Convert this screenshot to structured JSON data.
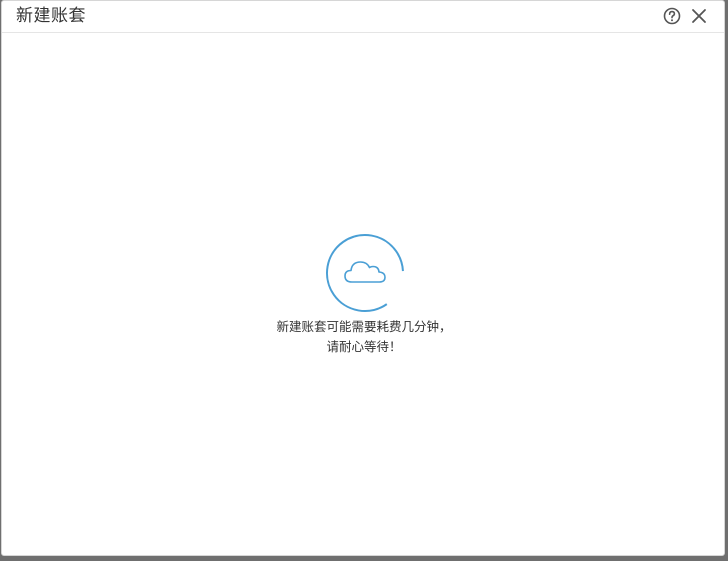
{
  "dialog": {
    "title": "新建账套",
    "help_icon": "help-circle-icon",
    "close_icon": "close-icon"
  },
  "loading": {
    "icon": "cloud-icon",
    "line1": "新建账套可能需要耗费几分钟，",
    "line2": "请耐心等待！",
    "accent_color": "#4a9fd5"
  }
}
